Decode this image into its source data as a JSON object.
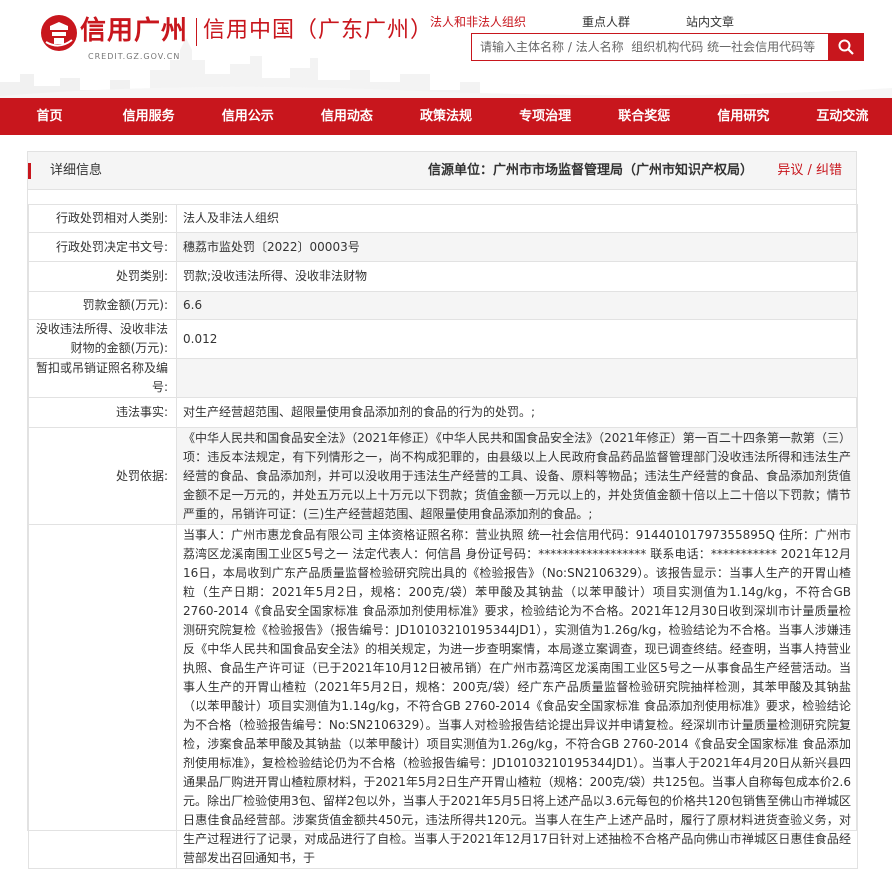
{
  "header": {
    "logo_text": "信用广州",
    "logo_url": "CREDIT.GZ.GOV.CN",
    "site_title": "信用中国（广东广州）",
    "tabs": [
      "法人和非法人组织",
      "重点人群",
      "站内文章"
    ],
    "search_placeholder": "请输入主体名称 / 法人名称  组织机构代码 统一社会信用代码等"
  },
  "nav": [
    "首页",
    "信用服务",
    "信用公示",
    "信用动态",
    "政策法规",
    "专项治理",
    "联合奖惩",
    "信用研究",
    "互动交流"
  ],
  "colors": {
    "brand": "#c8161d",
    "panel_bg": "#f5f5f5",
    "border": "#e2e2e2"
  },
  "panel": {
    "title": "详细信息",
    "source": "信源单位：广州市市场监督管理局（广州市知识产权局）",
    "report_link": "异议 / 纠错"
  },
  "rows": [
    {
      "label": "行政处罚相对人类别:",
      "value": "法人及非法人组织"
    },
    {
      "label": "行政处罚决定书文号:",
      "value": "穗荔市监处罚〔2022〕00003号"
    },
    {
      "label": "处罚类别:",
      "value": "罚款;没收违法所得、没收非法财物"
    },
    {
      "label": "罚款金额(万元):",
      "value": "6.6"
    },
    {
      "label": "没收违法所得、没收非法财物的金额(万元):",
      "value": "0.012"
    },
    {
      "label": "暂扣或吊销证照名称及编号:",
      "value": ""
    },
    {
      "label": "违法事实:",
      "value": "对生产经营超范围、超限量使用食品添加剂的食品的行为的处罚。;"
    },
    {
      "label": "处罚依据:",
      "value": "《中华人民共和国食品安全法》（2021年修正）《中华人民共和国食品安全法》（2021年修正）第一百二十四条第一款第（三）项：违反本法规定，有下列情形之一，尚不构成犯罪的，由县级以上人民政府食品药品监督管理部门没收违法所得和违法生产经营的食品、食品添加剂，并可以没收用于违法生产经营的工具、设备、原料等物品；违法生产经营的食品、食品添加剂货值金额不足一万元的，并处五万元以上十万元以下罚款；货值金额一万元以上的，并处货值金额十倍以上二十倍以下罚款；情节严重的，吊销许可证：(三)生产经营超范围、超限量使用食品添加剂的食品。;"
    },
    {
      "label": "",
      "value": "当事人：广州市惠龙食品有限公司 主体资格证照名称：营业执照 统一社会信用代码：91440101797355895Q 住所：广州市荔湾区龙溪南围工业区5号之一 法定代表人：何信昌 身份证号码：****************** 联系电话：*********** 2021年12月16日，本局收到广东产品质量监督检验研究院出具的《检验报告》（No:SN2106329）。该报告显示：当事人生产的开胃山楂粒（生产日期：2021年5月2日，规格：200克/袋）苯甲酸及其钠盐（以苯甲酸计）项目实测值为1.14g/kg，不符合GB 2760-2014《食品安全国家标准 食品添加剂使用标准》要求，检验结论为不合格。2021年12月30日收到深圳市计量质量检测研究院复检《检验报告》（报告编号：JD10103210195344JD1），实测值为1.26g/kg，检验结论为不合格。当事人涉嫌违反《中华人民共和国食品安全法》的相关规定，为进一步查明案情，本局遂立案调查，现已调查终结。经查明，当事人持营业执照、食品生产许可证（已于2021年10月12日被吊销）在广州市荔湾区龙溪南围工业区5号之一从事食品生产经营活动。当事人生产的开胃山楂粒（2021年5月2日，规格：200克/袋）经广东产品质量监督检验研究院抽样检测，其苯甲酸及其钠盐（以苯甲酸计）项目实测值为1.14g/kg，不符合GB 2760-2014《食品安全国家标准 食品添加剂使用标准》要求，检验结论为不合格（检验报告编号：No:SN2106329）。当事人对检验报告结论提出异议并申请复检。经深圳市计量质量检测研究院复检，涉案食品苯甲酸及其钠盐（以苯甲酸计）项目实测值为1.26g/kg，不符合GB 2760-2014《食品安全国家标准 食品添加剂使用标准》，复检检验结论仍为不合格（检验报告编号：JD10103210195344JD1）。当事人于2021年4月20日从新兴县四通果品厂购进开胃山楂粒原材料，于2021年5月2日生产开胃山楂粒（规格：200克/袋）共125包。当事人自称每包成本价2.6元。除出厂检验使用3包、留样2包以外，当事人于2021年5月5日将上述产品以3.6元每包的价格共120包销售至佛山市禅城区日惠佳食品经营部。涉案货值金额共450元，违法所得共120元。当事人在生产上述产品时，履行了原材料进货查验义务，对生产过程进行了记录，对成品进行了自检。当事人于2021年12月17日针对上述抽检不合格产品向佛山市禅城区日惠佳食品经营部发出召回通知书，于"
    }
  ]
}
